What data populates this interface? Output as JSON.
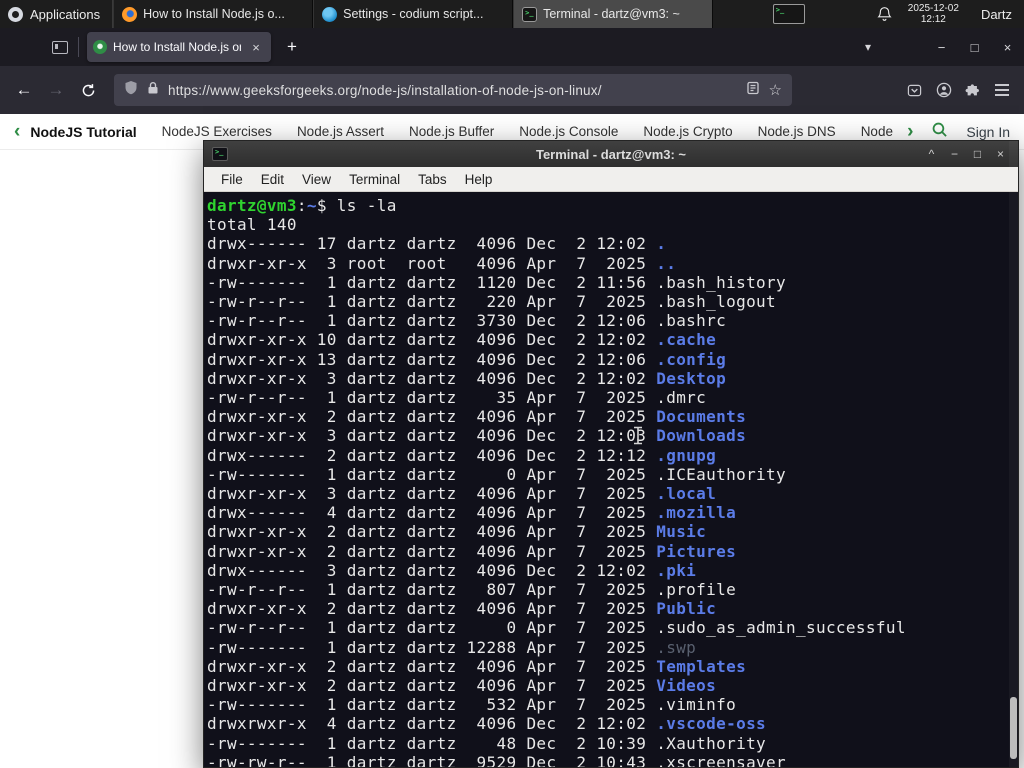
{
  "panel": {
    "applications_label": "Applications",
    "windows": [
      {
        "title": "How to Install Node.js o...",
        "icon": "firefox",
        "active": false
      },
      {
        "title": "Settings - codium script...",
        "icon": "codium",
        "active": false
      },
      {
        "title": "Terminal - dartz@vm3: ~",
        "icon": "terminal",
        "active": true
      }
    ],
    "clock": {
      "date": "2025-12-02",
      "time": "12:12"
    },
    "user_label": "Dartz"
  },
  "browser": {
    "tab_title": "How to Install Node.js on",
    "url": "https://www.geeksforgeeks.org/node-js/installation-of-node-js-on-linux/",
    "nav_links": [
      "NodeJS Tutorial",
      "NodeJS Exercises",
      "Node.js Assert",
      "Node.js Buffer",
      "Node.js Console",
      "Node.js Crypto",
      "Node.js DNS",
      "Node"
    ],
    "sign_in_label": "Sign In"
  },
  "terminal": {
    "title": "Terminal - dartz@vm3: ~",
    "menu": [
      "File",
      "Edit",
      "View",
      "Terminal",
      "Tabs",
      "Help"
    ],
    "prompt_user_host": "dartz@vm3",
    "prompt_separator": ":",
    "prompt_path": "~",
    "prompt_symbol": "$ ",
    "command": "ls -la",
    "total_line": "total 140",
    "files": [
      {
        "pre": "drwx------ 17 dartz dartz  4096 Dec  2 12:02 ",
        "name": ".",
        "t": "dir"
      },
      {
        "pre": "drwxr-xr-x  3 root  root   4096 Apr  7  2025 ",
        "name": "..",
        "t": "dir"
      },
      {
        "pre": "-rw-------  1 dartz dartz  1120 Dec  2 11:56 ",
        "name": ".bash_history",
        "t": "file"
      },
      {
        "pre": "-rw-r--r--  1 dartz dartz   220 Apr  7  2025 ",
        "name": ".bash_logout",
        "t": "file"
      },
      {
        "pre": "-rw-r--r--  1 dartz dartz  3730 Dec  2 12:06 ",
        "name": ".bashrc",
        "t": "file"
      },
      {
        "pre": "drwxr-xr-x 10 dartz dartz  4096 Dec  2 12:02 ",
        "name": ".cache",
        "t": "dir"
      },
      {
        "pre": "drwxr-xr-x 13 dartz dartz  4096 Dec  2 12:06 ",
        "name": ".config",
        "t": "dir"
      },
      {
        "pre": "drwxr-xr-x  3 dartz dartz  4096 Dec  2 12:02 ",
        "name": "Desktop",
        "t": "dir"
      },
      {
        "pre": "-rw-r--r--  1 dartz dartz    35 Apr  7  2025 ",
        "name": ".dmrc",
        "t": "file"
      },
      {
        "pre": "drwxr-xr-x  2 dartz dartz  4096 Apr  7  2025 ",
        "name": "Documents",
        "t": "dir"
      },
      {
        "pre": "drwxr-xr-x  3 dartz dartz  4096 Dec  2 12:03 ",
        "name": "Downloads",
        "t": "dir"
      },
      {
        "pre": "drwx------  2 dartz dartz  4096 Dec  2 12:12 ",
        "name": ".gnupg",
        "t": "dir"
      },
      {
        "pre": "-rw-------  1 dartz dartz     0 Apr  7  2025 ",
        "name": ".ICEauthority",
        "t": "file"
      },
      {
        "pre": "drwxr-xr-x  3 dartz dartz  4096 Apr  7  2025 ",
        "name": ".local",
        "t": "dir"
      },
      {
        "pre": "drwx------  4 dartz dartz  4096 Apr  7  2025 ",
        "name": ".mozilla",
        "t": "dir"
      },
      {
        "pre": "drwxr-xr-x  2 dartz dartz  4096 Apr  7  2025 ",
        "name": "Music",
        "t": "dir"
      },
      {
        "pre": "drwxr-xr-x  2 dartz dartz  4096 Apr  7  2025 ",
        "name": "Pictures",
        "t": "dir"
      },
      {
        "pre": "drwx------  3 dartz dartz  4096 Dec  2 12:02 ",
        "name": ".pki",
        "t": "dir"
      },
      {
        "pre": "-rw-r--r--  1 dartz dartz   807 Apr  7  2025 ",
        "name": ".profile",
        "t": "file"
      },
      {
        "pre": "drwxr-xr-x  2 dartz dartz  4096 Apr  7  2025 ",
        "name": "Public",
        "t": "dir"
      },
      {
        "pre": "-rw-r--r--  1 dartz dartz     0 Apr  7  2025 ",
        "name": ".sudo_as_admin_successful",
        "t": "file"
      },
      {
        "pre": "-rw-------  1 dartz dartz 12288 Apr  7  2025 ",
        "name": ".swp",
        "t": "dim"
      },
      {
        "pre": "drwxr-xr-x  2 dartz dartz  4096 Apr  7  2025 ",
        "name": "Templates",
        "t": "dir"
      },
      {
        "pre": "drwxr-xr-x  2 dartz dartz  4096 Apr  7  2025 ",
        "name": "Videos",
        "t": "dir"
      },
      {
        "pre": "-rw-------  1 dartz dartz   532 Apr  7  2025 ",
        "name": ".viminfo",
        "t": "file"
      },
      {
        "pre": "drwxrwxr-x  4 dartz dartz  4096 Dec  2 12:02 ",
        "name": ".vscode-oss",
        "t": "dir"
      },
      {
        "pre": "-rw-------  1 dartz dartz    48 Dec  2 10:39 ",
        "name": ".Xauthority",
        "t": "file"
      },
      {
        "pre": "-rw-rw-r--  1 dartz dartz  9529 Dec  2 10:43 ",
        "name": ".xscreensaver",
        "t": "file"
      }
    ]
  },
  "glyphs": {
    "back": "←",
    "forward": "→",
    "new_tab": "+",
    "list_tabs": "▾",
    "minimize": "−",
    "maximize": "□",
    "close": "×",
    "tab_close": "×",
    "star": "☆",
    "shade": "^",
    "chevron_left": "‹",
    "chevron_right": "›"
  },
  "colors": {
    "gfg_green": "#2f8d46",
    "dir_blue": "#5b7ce8",
    "prompt_green": "#2fd32f",
    "terminal_bg": "#10101a",
    "panel_bg": "#1d1d1d",
    "toolbar_bg": "#2b2a33"
  }
}
